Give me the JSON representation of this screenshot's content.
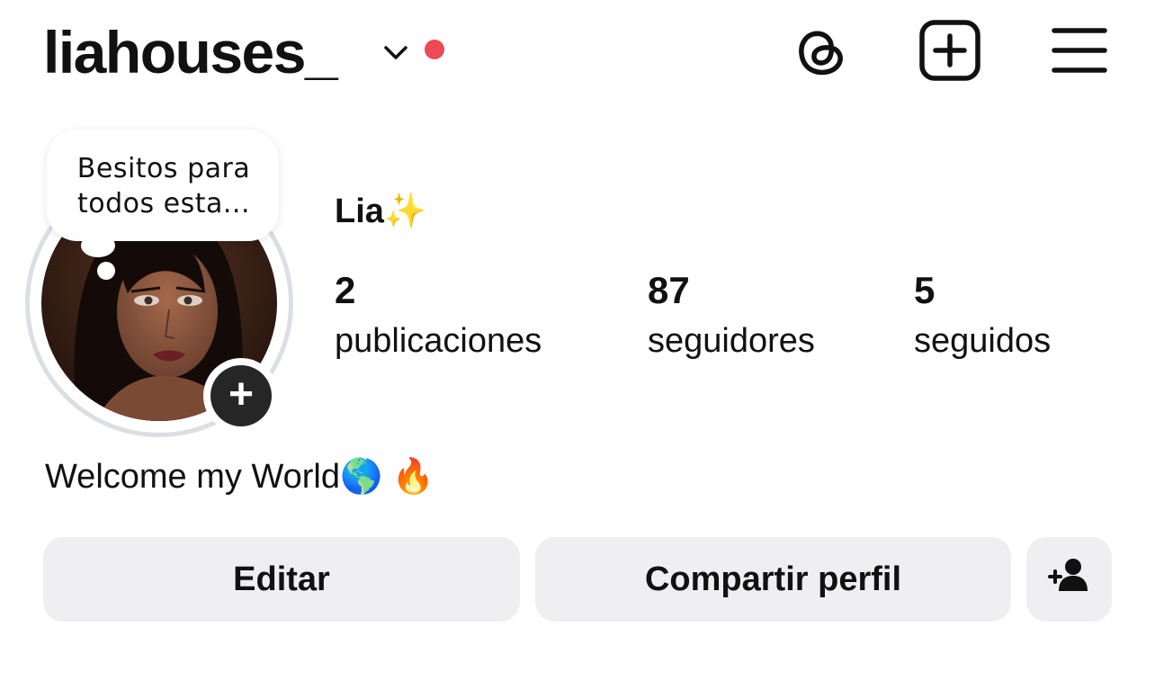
{
  "header": {
    "username": "liahouses_",
    "icons": {
      "chevron": "chevron-down-icon",
      "notification": "notification-dot",
      "threads": "threads-icon",
      "create": "create-post-icon",
      "menu": "hamburger-menu-icon"
    },
    "notification_color": "#ed4956"
  },
  "profile": {
    "note": "Besitos para todos esta...",
    "display_name": "Lia✨",
    "add_story_symbol": "+",
    "stats": [
      {
        "count": "2",
        "label": "publicaciones"
      },
      {
        "count": "87",
        "label": "seguidores"
      },
      {
        "count": "5",
        "label": "seguidos"
      }
    ],
    "bio": "Welcome my World🌎 🔥"
  },
  "actions": {
    "edit_label": "Editar",
    "share_label": "Compartir perfil",
    "discover_icon": "add-person-icon"
  },
  "colors": {
    "button_bg": "#efeff2",
    "text": "#111111",
    "avatar_ring": "#dbdfe4"
  }
}
